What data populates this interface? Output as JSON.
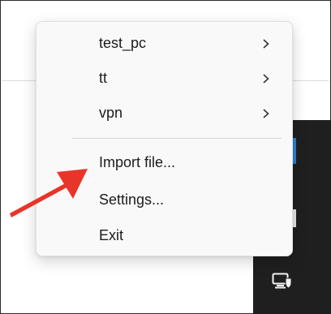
{
  "menu": {
    "items": [
      {
        "label": "test_pc",
        "has_submenu": true,
        "chevron_icon": "chevron-right-icon"
      },
      {
        "label": "tt",
        "has_submenu": true,
        "chevron_icon": "chevron-right-icon"
      },
      {
        "label": "vpn",
        "has_submenu": true,
        "chevron_icon": "chevron-right-icon"
      },
      {
        "label": "Import file...",
        "has_submenu": false
      },
      {
        "label": "Settings...",
        "has_submenu": false
      },
      {
        "label": "Exit",
        "has_submenu": false
      }
    ]
  },
  "annotation": {
    "icon": "red-arrow-icon",
    "color": "#e8352a",
    "points_to": "Import file..."
  },
  "taskbar": {
    "tray_icon": "network-shield-icon"
  },
  "colors": {
    "menu_bg": "#f9f9f9",
    "text": "#1b1b1b",
    "accent_blue": "#2f7fd4"
  }
}
